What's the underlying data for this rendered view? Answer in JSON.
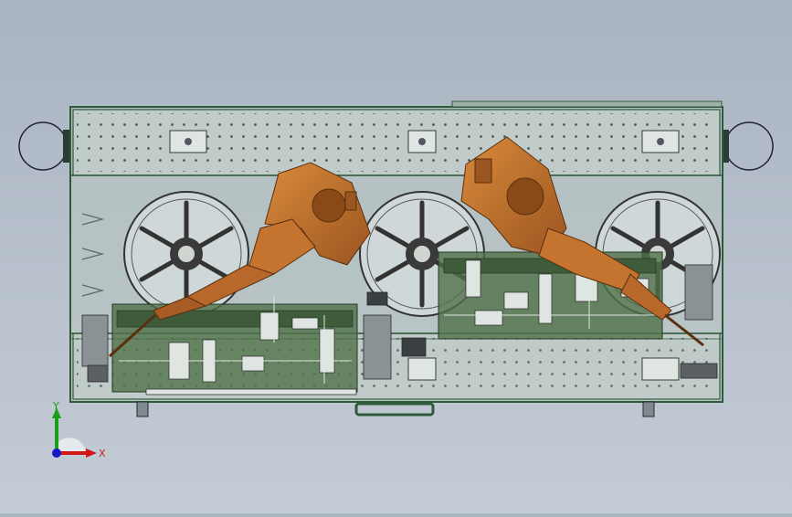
{
  "viewport": {
    "colors": {
      "frame": "#2f5a3a",
      "glass": "#b8c8c0",
      "robot": "#c0702a",
      "robot_dark": "#7a4215",
      "fixture": "#4f7048",
      "wheel": "#e8ecee"
    }
  },
  "triad": {
    "x_label": "X",
    "y_label": "Y",
    "x_color": "#d01818",
    "y_color": "#18a018",
    "z_color": "#1818c8"
  }
}
